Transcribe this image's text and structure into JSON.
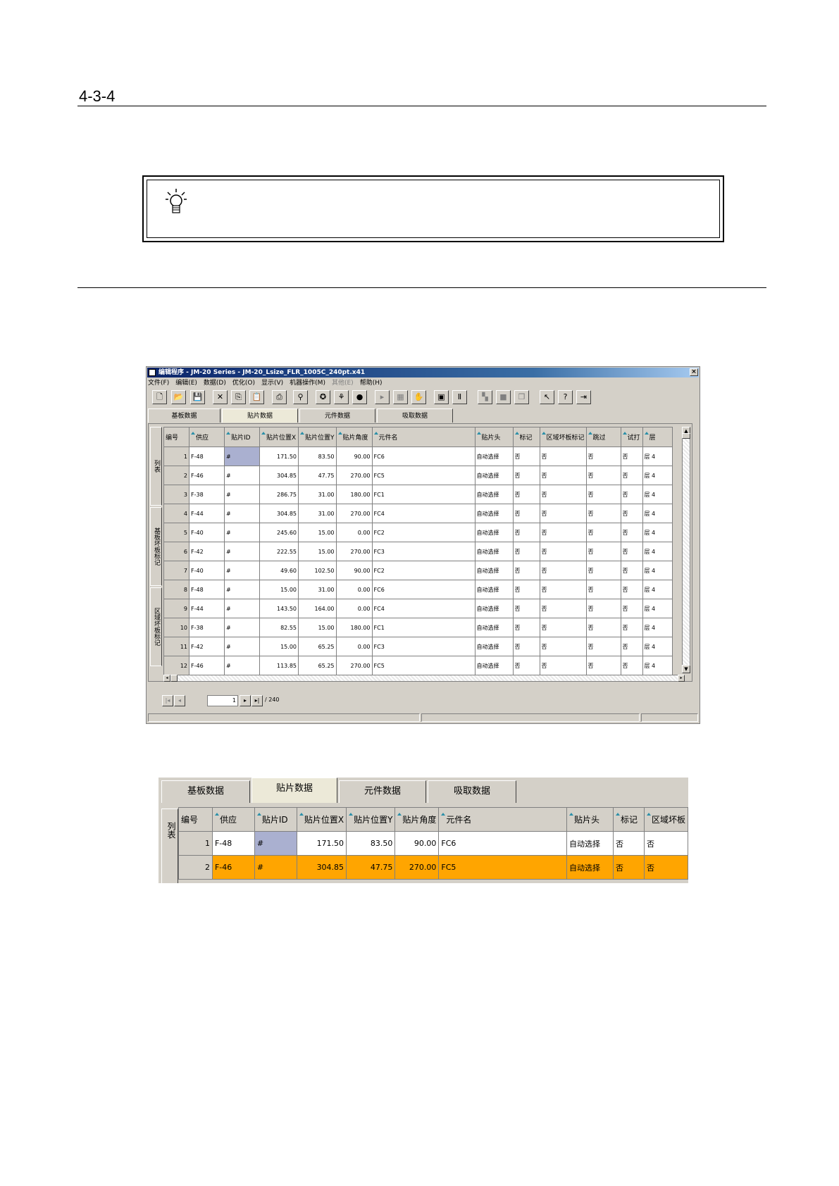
{
  "page": {
    "section_number": "4-3-4"
  },
  "window": {
    "title": "编辑程序 - JM-20 Series - JM-20_Lsize_FLR_1005C_240pt.x41",
    "close_label": "×",
    "menu": [
      "文件(F)",
      "编辑(E)",
      "数据(D)",
      "优化(O)",
      "显示(V)",
      "机器操作(M)",
      "其他(E)",
      "帮助(H)"
    ],
    "menu_disabled": [
      "其他(E)"
    ],
    "toolbar_icons": [
      "new-file-icon",
      "open-folder-icon",
      "save-icon",
      "cut-icon",
      "copy-icon",
      "paste-icon",
      "print-icon",
      "find-icon",
      "bulb-icon",
      "tree-icon",
      "color-circles-icon",
      "step-icon",
      "grid-icon",
      "hand-icon",
      "board-icon",
      "align-icon",
      "dim-block-icon",
      "stop-icon",
      "copy-block-icon",
      "help-pointer-icon",
      "help-icon",
      "exit-icon"
    ],
    "tabs": [
      "基板数据",
      "贴片数据",
      "元件数据",
      "吸取数据"
    ],
    "active_tab": "贴片数据",
    "side_tabs": [
      "列表",
      "基板坏板标记",
      "区域坏板标记"
    ],
    "columns": [
      "编号",
      "供应",
      "贴片ID",
      "贴片位置X",
      "贴片位置Y",
      "贴片角度",
      "元件名",
      "贴片头",
      "标记",
      "区域坏板标记",
      "跳过",
      "试打",
      "层"
    ],
    "rows": [
      [
        "1",
        "F-48",
        "#",
        "171.50",
        "83.50",
        "90.00",
        "FC6",
        "自动选择",
        "否",
        "否",
        "否",
        "否",
        "层 4"
      ],
      [
        "2",
        "F-46",
        "#",
        "304.85",
        "47.75",
        "270.00",
        "FC5",
        "自动选择",
        "否",
        "否",
        "否",
        "否",
        "层 4"
      ],
      [
        "3",
        "F-38",
        "#",
        "286.75",
        "31.00",
        "180.00",
        "FC1",
        "自动选择",
        "否",
        "否",
        "否",
        "否",
        "层 4"
      ],
      [
        "4",
        "F-44",
        "#",
        "304.85",
        "31.00",
        "270.00",
        "FC4",
        "自动选择",
        "否",
        "否",
        "否",
        "否",
        "层 4"
      ],
      [
        "5",
        "F-40",
        "#",
        "245.60",
        "15.00",
        "0.00",
        "FC2",
        "自动选择",
        "否",
        "否",
        "否",
        "否",
        "层 4"
      ],
      [
        "6",
        "F-42",
        "#",
        "222.55",
        "15.00",
        "270.00",
        "FC3",
        "自动选择",
        "否",
        "否",
        "否",
        "否",
        "层 4"
      ],
      [
        "7",
        "F-40",
        "#",
        "49.60",
        "102.50",
        "90.00",
        "FC2",
        "自动选择",
        "否",
        "否",
        "否",
        "否",
        "层 4"
      ],
      [
        "8",
        "F-48",
        "#",
        "15.00",
        "31.00",
        "0.00",
        "FC6",
        "自动选择",
        "否",
        "否",
        "否",
        "否",
        "层 4"
      ],
      [
        "9",
        "F-44",
        "#",
        "143.50",
        "164.00",
        "0.00",
        "FC4",
        "自动选择",
        "否",
        "否",
        "否",
        "否",
        "层 4"
      ],
      [
        "10",
        "F-38",
        "#",
        "82.55",
        "15.00",
        "180.00",
        "FC1",
        "自动选择",
        "否",
        "否",
        "否",
        "否",
        "层 4"
      ],
      [
        "11",
        "F-42",
        "#",
        "15.00",
        "65.25",
        "0.00",
        "FC3",
        "自动选择",
        "否",
        "否",
        "否",
        "否",
        "层 4"
      ],
      [
        "12",
        "F-46",
        "#",
        "113.85",
        "65.25",
        "270.00",
        "FC5",
        "自动选择",
        "否",
        "否",
        "否",
        "否",
        "层 4"
      ]
    ],
    "pager": {
      "current": "1",
      "total": "/ 240",
      "first": "|◂",
      "prev": "◂",
      "next": "▸",
      "last": "▸|"
    }
  },
  "zoom": {
    "tabs": [
      "基板数据",
      "贴片数据",
      "元件数据",
      "吸取数据"
    ],
    "side_tab": "列表",
    "columns": [
      "编号",
      "供应",
      "贴片ID",
      "贴片位置X",
      "贴片位置Y",
      "贴片角度",
      "元件名",
      "贴片头",
      "标记",
      "区域坏板"
    ],
    "rows": [
      [
        "1",
        "F-48",
        "#",
        "171.50",
        "83.50",
        "90.00",
        "FC6",
        "自动选择",
        "否",
        "否"
      ],
      [
        "2",
        "F-46",
        "#",
        "304.85",
        "47.75",
        "270.00",
        "FC5",
        "自动选择",
        "否",
        "否"
      ]
    ],
    "highlight_color": "#ffa500"
  },
  "colors": {
    "title_bar": "#0a246a",
    "selection": "#aab0d0",
    "face": "#d4d0c8"
  }
}
